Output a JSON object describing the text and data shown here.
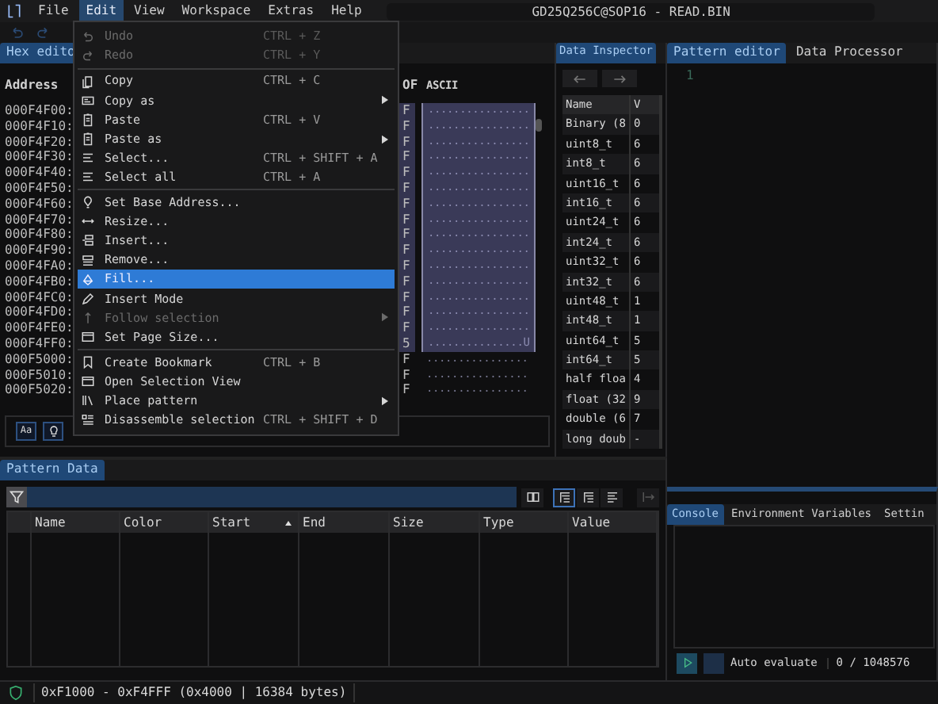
{
  "menu_bar": {
    "items": [
      {
        "label": "File",
        "selected": false
      },
      {
        "label": "Edit",
        "selected": true
      },
      {
        "label": "View",
        "selected": false
      },
      {
        "label": "Workspace",
        "selected": false
      },
      {
        "label": "Extras",
        "selected": false
      },
      {
        "label": "Help",
        "selected": false
      }
    ]
  },
  "title": "GD25Q256C@SOP16 - READ.BIN",
  "hex_editor": {
    "tab": "Hex edito",
    "address_header": "Address",
    "hex_header": "OF",
    "ascii_header": "ASCII",
    "footer_button": "Aa",
    "rows": [
      {
        "address": "000F4F00:",
        "hex": "F",
        "ascii": "................",
        "selected": true
      },
      {
        "address": "000F4F10:",
        "hex": "F",
        "ascii": "................",
        "selected": true
      },
      {
        "address": "000F4F20:",
        "hex": "F",
        "ascii": "................",
        "selected": true
      },
      {
        "address": "000F4F30:",
        "hex": "F",
        "ascii": "................",
        "selected": true
      },
      {
        "address": "000F4F40:",
        "hex": "F",
        "ascii": "................",
        "selected": true
      },
      {
        "address": "000F4F50:",
        "hex": "F",
        "ascii": "................",
        "selected": true
      },
      {
        "address": "000F4F60:",
        "hex": "F",
        "ascii": "................",
        "selected": true
      },
      {
        "address": "000F4F70:",
        "hex": "F",
        "ascii": "................",
        "selected": true
      },
      {
        "address": "000F4F80:",
        "hex": "F",
        "ascii": "................",
        "selected": true
      },
      {
        "address": "000F4F90:",
        "hex": "F",
        "ascii": "................",
        "selected": true
      },
      {
        "address": "000F4FA0:",
        "hex": "F",
        "ascii": "................",
        "selected": true
      },
      {
        "address": "000F4FB0:",
        "hex": "F",
        "ascii": "................",
        "selected": true
      },
      {
        "address": "000F4FC0:",
        "hex": "F",
        "ascii": "................",
        "selected": true
      },
      {
        "address": "000F4FD0:",
        "hex": "F",
        "ascii": "................",
        "selected": true
      },
      {
        "address": "000F4FE0:",
        "hex": "F",
        "ascii": "................",
        "selected": true
      },
      {
        "address": "000F4FF0:",
        "hex": "5",
        "ascii": "...............U",
        "selected": true
      },
      {
        "address": "000F5000:",
        "hex": "F",
        "ascii": "................",
        "selected": false
      },
      {
        "address": "000F5010:",
        "hex": "F",
        "ascii": "................",
        "selected": false
      },
      {
        "address": "000F5020:",
        "hex": "F",
        "ascii": "................",
        "selected": false
      }
    ]
  },
  "edit_menu": [
    {
      "kind": "item",
      "label": "Undo",
      "shortcut": "CTRL + Z",
      "disabled": true,
      "selected": false,
      "submenu": false
    },
    {
      "kind": "item",
      "label": "Redo",
      "shortcut": "CTRL + Y",
      "disabled": true,
      "selected": false,
      "submenu": false
    },
    {
      "kind": "separator"
    },
    {
      "kind": "item",
      "label": "Copy",
      "shortcut": "CTRL + C",
      "disabled": false,
      "selected": false,
      "submenu": false
    },
    {
      "kind": "item",
      "label": "Copy as",
      "disabled": false,
      "selected": false,
      "submenu": true
    },
    {
      "kind": "item",
      "label": "Paste",
      "shortcut": "CTRL + V",
      "disabled": false,
      "selected": false,
      "submenu": false
    },
    {
      "kind": "item",
      "label": "Paste as",
      "disabled": false,
      "selected": false,
      "submenu": true
    },
    {
      "kind": "item",
      "label": "Select...",
      "shortcut": "CTRL + SHIFT + A",
      "disabled": false,
      "selected": false,
      "submenu": false
    },
    {
      "kind": "item",
      "label": "Select all",
      "shortcut": "CTRL + A",
      "disabled": false,
      "selected": false,
      "submenu": false
    },
    {
      "kind": "separator"
    },
    {
      "kind": "item",
      "label": "Set Base Address...",
      "disabled": false,
      "selected": false,
      "submenu": false
    },
    {
      "kind": "item",
      "label": "Resize...",
      "disabled": false,
      "selected": false,
      "submenu": false
    },
    {
      "kind": "item",
      "label": "Insert...",
      "disabled": false,
      "selected": false,
      "submenu": false
    },
    {
      "kind": "item",
      "label": "Remove...",
      "disabled": false,
      "selected": false,
      "submenu": false
    },
    {
      "kind": "item",
      "label": "Fill...",
      "disabled": false,
      "selected": true,
      "submenu": false
    },
    {
      "kind": "item",
      "label": "Insert Mode",
      "disabled": false,
      "selected": false,
      "submenu": false
    },
    {
      "kind": "item",
      "label": "Follow selection",
      "disabled": true,
      "selected": false,
      "submenu": true
    },
    {
      "kind": "item",
      "label": "Set Page Size...",
      "disabled": false,
      "selected": false,
      "submenu": false
    },
    {
      "kind": "separator"
    },
    {
      "kind": "item",
      "label": "Create Bookmark",
      "shortcut": "CTRL + B",
      "disabled": false,
      "selected": false,
      "submenu": false
    },
    {
      "kind": "item",
      "label": "Open Selection View",
      "disabled": false,
      "selected": false,
      "submenu": false
    },
    {
      "kind": "item",
      "label": "Place pattern",
      "disabled": false,
      "selected": false,
      "submenu": true
    },
    {
      "kind": "item",
      "label": "Disassemble selection",
      "shortcut": "CTRL + SHIFT + D",
      "disabled": false,
      "selected": false,
      "submenu": false
    }
  ],
  "data_inspector": {
    "tab": "Data Inspector",
    "columns": [
      "Name",
      "V"
    ],
    "rows": [
      {
        "name": "Binary (8",
        "value": "0"
      },
      {
        "name": "uint8_t",
        "value": "6"
      },
      {
        "name": "int8_t",
        "value": "6"
      },
      {
        "name": "uint16_t",
        "value": "6"
      },
      {
        "name": "int16_t",
        "value": "6"
      },
      {
        "name": "uint24_t",
        "value": "6"
      },
      {
        "name": "int24_t",
        "value": "6"
      },
      {
        "name": "uint32_t",
        "value": "6"
      },
      {
        "name": "int32_t",
        "value": "6"
      },
      {
        "name": "uint48_t",
        "value": "1"
      },
      {
        "name": "int48_t",
        "value": "1"
      },
      {
        "name": "uint64_t",
        "value": "5"
      },
      {
        "name": "int64_t",
        "value": "5"
      },
      {
        "name": "half floa",
        "value": "4"
      },
      {
        "name": "float (32",
        "value": "9"
      },
      {
        "name": "double (6",
        "value": "7"
      },
      {
        "name": "long doub",
        "value": "-"
      }
    ]
  },
  "pattern_editor": {
    "tabs": [
      {
        "label": "Pattern editor",
        "selected": true
      },
      {
        "label": "Data Processor",
        "selected": false
      }
    ],
    "line_number": "1"
  },
  "console": {
    "tabs": [
      {
        "label": "Console",
        "selected": true
      },
      {
        "label": "Environment Variables",
        "selected": false
      },
      {
        "label": "Settin",
        "selected": false
      }
    ],
    "auto_evaluate": {
      "label": "Auto evaluate",
      "checked": false
    },
    "counter": "0 / 1048576"
  },
  "pattern_data": {
    "tab": "Pattern Data",
    "view_modes": [
      {
        "selected": true
      },
      {
        "selected": false
      },
      {
        "selected": false
      }
    ],
    "columns": [
      {
        "sorted": false
      },
      {
        "label": "Name",
        "sorted": false
      },
      {
        "label": "Color",
        "sorted": false
      },
      {
        "label": "Start",
        "sorted": true
      },
      {
        "label": "End",
        "sorted": false
      },
      {
        "label": "Size",
        "sorted": false
      },
      {
        "label": "Type",
        "sorted": false
      },
      {
        "label": "Value",
        "sorted": false
      }
    ]
  },
  "status_bar": {
    "text": "0xF1000 - 0xF4FFF (0x4000 | 16384 bytes)"
  }
}
